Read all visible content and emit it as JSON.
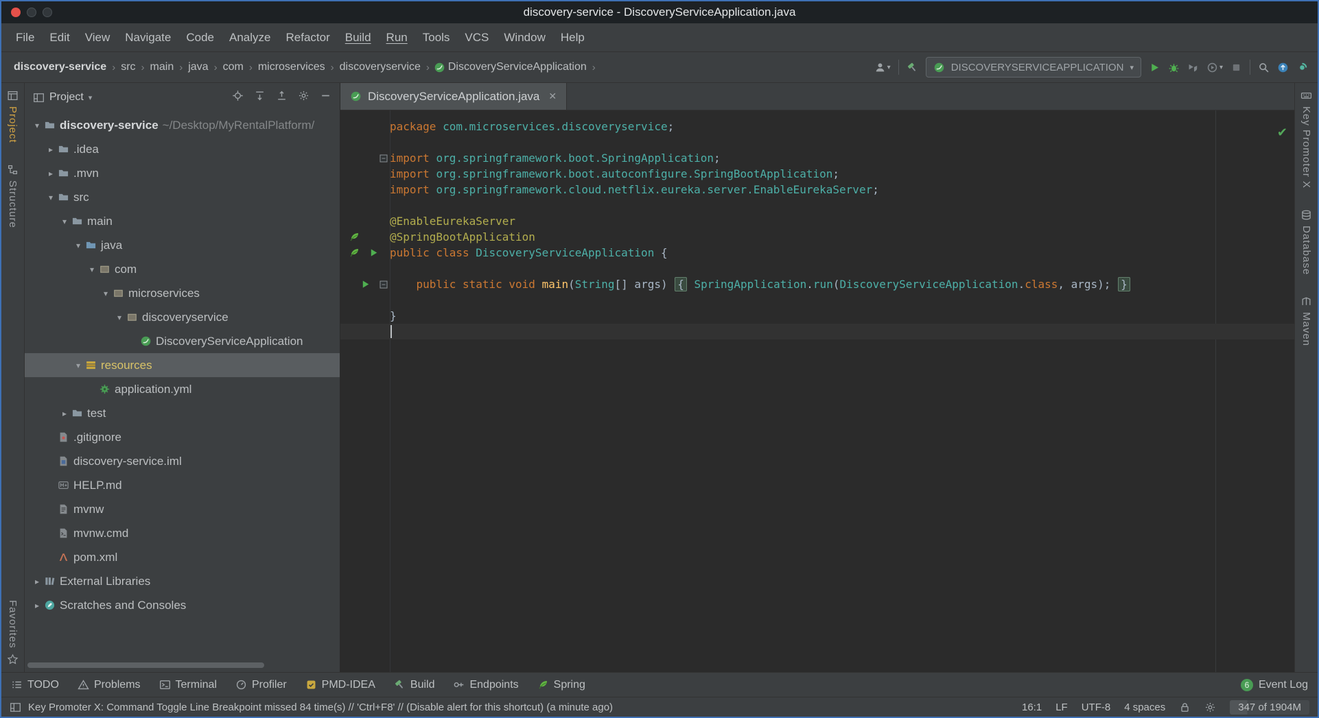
{
  "window": {
    "title": "discovery-service - DiscoveryServiceApplication.java"
  },
  "menu_bar": {
    "items": [
      {
        "label": "File"
      },
      {
        "label": "Edit"
      },
      {
        "label": "View"
      },
      {
        "label": "Navigate"
      },
      {
        "label": "Code"
      },
      {
        "label": "Analyze"
      },
      {
        "label": "Refactor"
      },
      {
        "label": "Build",
        "underlined": true
      },
      {
        "label": "Run",
        "underlined": true
      },
      {
        "label": "Tools"
      },
      {
        "label": "VCS"
      },
      {
        "label": "Window"
      },
      {
        "label": "Help"
      }
    ]
  },
  "breadcrumbs": {
    "items": [
      {
        "label": "discovery-service"
      },
      {
        "label": "src"
      },
      {
        "label": "main"
      },
      {
        "label": "java"
      },
      {
        "label": "com"
      },
      {
        "label": "microservices"
      },
      {
        "label": "discoveryservice"
      },
      {
        "label": "DiscoveryServiceApplication",
        "icon": "spring-boot-icon"
      }
    ]
  },
  "run_toolbar": {
    "run_config_label": "DISCOVERYSERVICEAPPLICATION",
    "items": [
      {
        "type": "icon",
        "name": "user-icon",
        "arrow": true
      },
      {
        "type": "sep"
      },
      {
        "type": "icon",
        "name": "build-hammer-icon"
      },
      {
        "type": "combo",
        "icon": "spring-boot-icon"
      },
      {
        "type": "icon",
        "name": "run-icon"
      },
      {
        "type": "icon",
        "name": "debug-icon"
      },
      {
        "type": "icon",
        "name": "coverage-icon"
      },
      {
        "type": "icon",
        "name": "profiler-icon",
        "arrow": true
      },
      {
        "type": "icon",
        "name": "stop-icon"
      },
      {
        "type": "sep"
      },
      {
        "type": "icon",
        "name": "search-everywhere-icon"
      },
      {
        "type": "icon",
        "name": "update-icon"
      },
      {
        "type": "icon",
        "name": "settings-sync-icon"
      }
    ]
  },
  "left_stripe": {
    "top": [
      {
        "icon": "project-stripe-icon",
        "label": "Project",
        "active": true
      },
      {
        "icon": "structure-stripe-icon",
        "label": "Structure"
      }
    ],
    "bottom": [
      {
        "icon": "favorites-star-icon",
        "label": "Favorites",
        "icon_after": true
      }
    ]
  },
  "right_stripe": {
    "top": [
      {
        "icon": "keyboard-icon",
        "label": "Key Promoter X"
      },
      {
        "icon": "database-icon",
        "label": "Database"
      },
      {
        "icon": "maven-m-icon",
        "label": "Maven"
      }
    ]
  },
  "project_panel": {
    "title": "Project",
    "header_icons": [
      "locate-icon",
      "expand-all-icon",
      "collapse-all-icon",
      "settings-gear-icon",
      "hide-panel-icon"
    ],
    "tree": [
      {
        "label": "discovery-service",
        "suffix": " ~/Desktop/MyRentalPlatform/",
        "level": 0,
        "state": "expanded",
        "icon": "folder-icon",
        "bold": true
      },
      {
        "label": ".idea",
        "level": 1,
        "state": "collapsed",
        "icon": "folder-icon"
      },
      {
        "label": ".mvn",
        "level": 1,
        "state": "collapsed",
        "icon": "folder-icon"
      },
      {
        "label": "src",
        "level": 1,
        "state": "expanded",
        "icon": "folder-icon"
      },
      {
        "label": "main",
        "level": 2,
        "state": "expanded",
        "icon": "folder-icon"
      },
      {
        "label": "java",
        "level": 3,
        "state": "expanded",
        "icon": "folder-source-icon"
      },
      {
        "label": "com",
        "level": 4,
        "state": "expanded",
        "icon": "package-icon"
      },
      {
        "label": "microservices",
        "level": 5,
        "state": "expanded",
        "icon": "package-icon"
      },
      {
        "label": "discoveryservice",
        "level": 6,
        "state": "expanded",
        "icon": "package-icon"
      },
      {
        "label": "DiscoveryServiceApplication",
        "level": 7,
        "icon": "spring-boot-icon"
      },
      {
        "label": "resources",
        "level": 3,
        "state": "expanded",
        "icon": "folder-resources-icon",
        "selected": true
      },
      {
        "label": "application.yml",
        "level": 4,
        "icon": "spring-config-icon"
      },
      {
        "label": "test",
        "level": 2,
        "state": "collapsed",
        "icon": "folder-icon"
      },
      {
        "label": ".gitignore",
        "level": 1,
        "icon": "file-git-icon"
      },
      {
        "label": "discovery-service.iml",
        "level": 1,
        "icon": "file-iml-icon"
      },
      {
        "label": "HELP.md",
        "level": 1,
        "icon": "file-md-icon"
      },
      {
        "label": "mvnw",
        "level": 1,
        "icon": "file-text-icon"
      },
      {
        "label": "mvnw.cmd",
        "level": 1,
        "icon": "file-cmd-icon"
      },
      {
        "label": "pom.xml",
        "level": 1,
        "icon": "maven-file-icon"
      },
      {
        "label": "External Libraries",
        "level": 0,
        "state": "collapsed",
        "icon": "libraries-icon"
      },
      {
        "label": "Scratches and Consoles",
        "level": 0,
        "state": "collapsed",
        "icon": "scratches-icon"
      }
    ]
  },
  "editor": {
    "tab": {
      "icon": "spring-boot-icon",
      "label": "DiscoveryServiceApplication.java"
    },
    "inspection_status": "ok",
    "code": {
      "lines": [
        {
          "tokens": [
            {
              "t": "package ",
              "c": "kw"
            },
            {
              "t": "com.microservices.discoveryservice",
              "c": "ref"
            },
            {
              "t": ";",
              "c": "pl"
            }
          ]
        },
        {
          "tokens": []
        },
        {
          "fold": true,
          "tokens": [
            {
              "t": "import ",
              "c": "kw"
            },
            {
              "t": "org.springframework.boot.SpringApplication",
              "c": "ref"
            },
            {
              "t": ";",
              "c": "pl"
            }
          ]
        },
        {
          "tokens": [
            {
              "t": "import ",
              "c": "kw"
            },
            {
              "t": "org.springframework.boot.autoconfigure.SpringBootApplication",
              "c": "ref"
            },
            {
              "t": ";",
              "c": "pl"
            }
          ]
        },
        {
          "tokens": [
            {
              "t": "import ",
              "c": "kw"
            },
            {
              "t": "org.springframework.cloud.netflix.eureka.server.EnableEurekaServer",
              "c": "ref"
            },
            {
              "t": ";",
              "c": "pl"
            }
          ]
        },
        {
          "tokens": []
        },
        {
          "tokens": [
            {
              "t": "@EnableEurekaServer",
              "c": "ann"
            }
          ]
        },
        {
          "gutter": [
            "spring-bean-icon"
          ],
          "tokens": [
            {
              "t": "@SpringBootApplication",
              "c": "ann"
            }
          ]
        },
        {
          "gutter": [
            "spring-bean-icon",
            "run-gutter-icon"
          ],
          "tokens": [
            {
              "t": "public class ",
              "c": "kw"
            },
            {
              "t": "DiscoveryServiceApplication",
              "c": "ref"
            },
            {
              "t": " {",
              "c": "pl"
            }
          ]
        },
        {
          "tokens": []
        },
        {
          "gutter": [
            "run-gutter-icon"
          ],
          "fold": true,
          "tokens": [
            {
              "t": "    ",
              "c": "pl"
            },
            {
              "t": "public static void ",
              "c": "kw"
            },
            {
              "t": "main",
              "c": "mth"
            },
            {
              "t": "(",
              "c": "pl"
            },
            {
              "t": "String",
              "c": "ref"
            },
            {
              "t": "[] args) ",
              "c": "pl"
            },
            {
              "t": "{",
              "c": "fold"
            },
            {
              "t": " ",
              "c": "pl"
            },
            {
              "t": "SpringApplication",
              "c": "ref"
            },
            {
              "t": ".",
              "c": "pl"
            },
            {
              "t": "run",
              "c": "ref"
            },
            {
              "t": "(",
              "c": "pl"
            },
            {
              "t": "DiscoveryServiceApplication",
              "c": "ref"
            },
            {
              "t": ".",
              "c": "pl"
            },
            {
              "t": "class",
              "c": "kw"
            },
            {
              "t": ", args); ",
              "c": "pl"
            },
            {
              "t": "}",
              "c": "fold"
            }
          ]
        },
        {
          "tokens": []
        },
        {
          "tokens": [
            {
              "t": "}",
              "c": "pl"
            }
          ]
        },
        {
          "caret": true,
          "tokens": []
        }
      ]
    }
  },
  "bottom_bar": {
    "items": [
      {
        "icon": "todo-icon",
        "label": "TODO"
      },
      {
        "icon": "problems-icon",
        "label": "Problems"
      },
      {
        "icon": "terminal-icon",
        "label": "Terminal"
      },
      {
        "icon": "profiler-gauge-icon",
        "label": "Profiler"
      },
      {
        "icon": "pmd-icon",
        "label": "PMD-IDEA"
      },
      {
        "icon": "build-hammer-icon",
        "label": "Build"
      },
      {
        "icon": "endpoints-icon",
        "label": "Endpoints"
      },
      {
        "icon": "spring-leaf-icon",
        "label": "Spring"
      }
    ],
    "right": {
      "badge": "6",
      "label": "Event Log"
    }
  },
  "status_bar": {
    "message": "Key Promoter X: Command Toggle Line Breakpoint missed 84 time(s) // 'Ctrl+F8' // (Disable alert for this shortcut) (a minute ago)",
    "caret_position": "16:1",
    "line_separator": "LF",
    "encoding": "UTF-8",
    "indent": "4 spaces",
    "memory": "347 of 1904M"
  },
  "colors": {
    "accent_green": "#499C54",
    "keyword_orange": "#cc7832",
    "reference_teal": "#4db0a8",
    "annotation_yellow": "#b3ae4e",
    "selection_gray": "#595d60",
    "editor_bg": "#2b2b2b",
    "panel_bg": "#3c3f41"
  }
}
